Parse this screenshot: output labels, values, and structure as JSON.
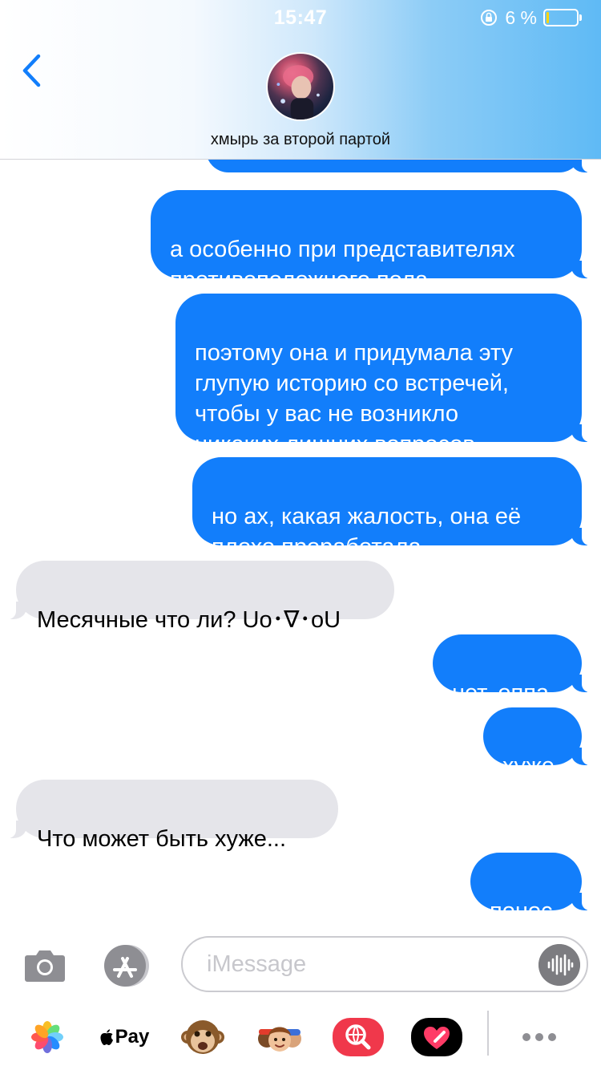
{
  "status_bar": {
    "time": "15:47",
    "battery_text": "6 %",
    "battery_level_percent": 6,
    "icons": [
      "orientation-lock-icon",
      "battery-icon"
    ]
  },
  "header": {
    "contact_name": "хмырь за второй партой",
    "back_icon": "chevron-left-icon",
    "avatar": "contact-avatar-photo"
  },
  "messages": [
    {
      "direction": "outgoing",
      "text": ""
    },
    {
      "direction": "outgoing",
      "text": "а особенно при представителях\nпротивоположного пола"
    },
    {
      "direction": "outgoing",
      "text": "поэтому она и придумала эту\nглупую историю со встречей,\nчтобы у вас не возникло\nникаких лишних вопросов"
    },
    {
      "direction": "outgoing",
      "text": "но ах, какая жалость, она её\nплохо проработала"
    },
    {
      "direction": "incoming",
      "text": "Месячные что ли? Uo･∇･oU"
    },
    {
      "direction": "outgoing",
      "text": "нет, оппа"
    },
    {
      "direction": "outgoing",
      "text": "хуже"
    },
    {
      "direction": "incoming",
      "text": "Что может быть хуже..."
    },
    {
      "direction": "outgoing",
      "text": "понос"
    }
  ],
  "input_bar": {
    "placeholder": "iMessage",
    "icons": [
      "camera-icon",
      "app-store-icon",
      "audio-waveform-icon"
    ]
  },
  "app_drawer": {
    "applepay_label": "Pay",
    "icons": [
      "photos-icon",
      "apple-pay-icon",
      "animoji-monkey-icon",
      "memoji-icon",
      "web-image-search-icon",
      "digital-touch-heart-icon",
      "more-icon"
    ]
  },
  "colors": {
    "outgoing_bubble": "#127efb",
    "incoming_bubble": "#e5e5ea",
    "tint": "#127efb",
    "header_gradient_end": "#5fbaf5"
  }
}
